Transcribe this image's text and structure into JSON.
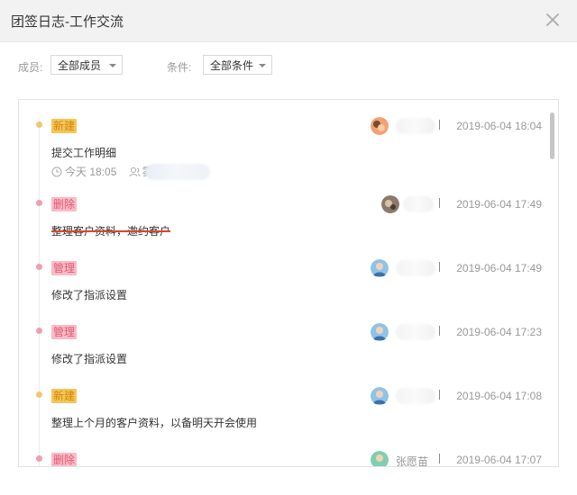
{
  "dialog": {
    "title": "团签日志-工作交流"
  },
  "filters": {
    "member_label": "成员:",
    "member_value": "全部成员",
    "condition_label": "条件:",
    "condition_value": "全部条件"
  },
  "colors": {
    "new_tag_bg": "#f5c659",
    "new_tag_text": "#d48706",
    "new_dot": "#f1c76e",
    "delete_tag_bg": "#f8bcc6",
    "delete_tag_text": "#e05b74",
    "delete_dot": "#ef9fae",
    "manage_tag_bg": "#f8bcc6",
    "manage_tag_text": "#e05b74",
    "manage_dot": "#ef9fae"
  },
  "entries": [
    {
      "tag": "新建",
      "desc": "提交工作明细",
      "time": "2019-06-04 18:04",
      "meta_time": "今天 18:05",
      "meta_person": "雾"
    },
    {
      "tag": "删除",
      "desc": "整理客户资料，邀约客户",
      "time": "2019-06-04 17:49"
    },
    {
      "tag": "管理",
      "desc": "修改了指派设置",
      "time": "2019-06-04 17:49"
    },
    {
      "tag": "管理",
      "desc": "修改了指派设置",
      "time": "2019-06-04 17:23"
    },
    {
      "tag": "新建",
      "desc": "整理上个月的客户资料，以备明天开会使用",
      "time": "2019-06-04 17:08"
    },
    {
      "tag": "删除",
      "time": "2019-06-04 17:07",
      "name": "张愿苗"
    }
  ]
}
